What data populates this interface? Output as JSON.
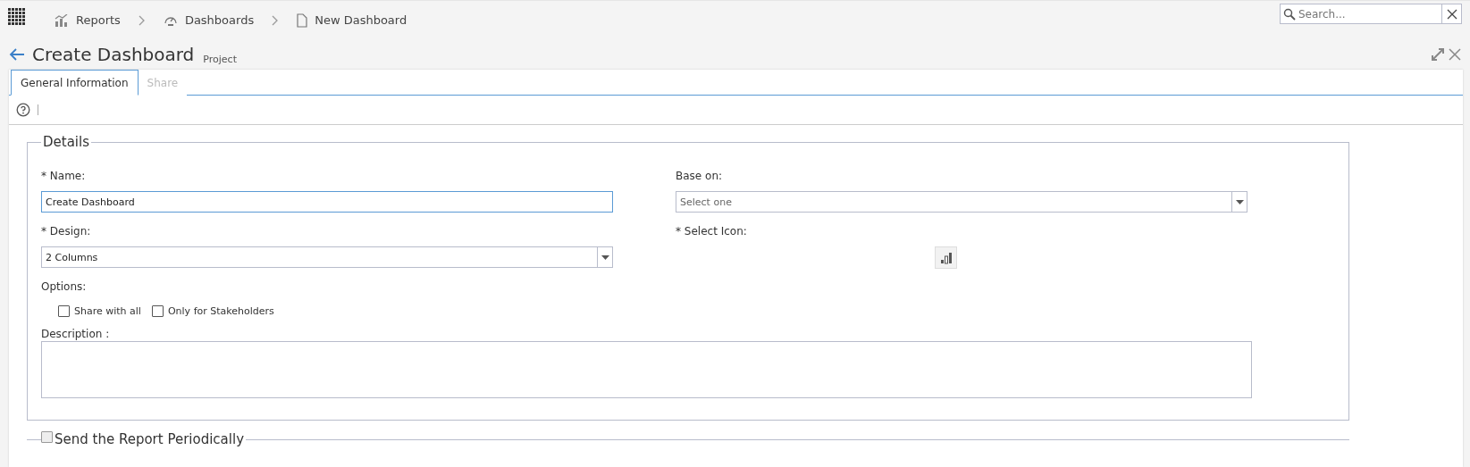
{
  "breadcrumbs": [
    {
      "label": "Reports"
    },
    {
      "label": "Dashboards"
    },
    {
      "label": "New Dashboard"
    }
  ],
  "search": {
    "placeholder": "Search..."
  },
  "page": {
    "title": "Create Dashboard",
    "subtitle": "Project"
  },
  "tabs": [
    {
      "label": "General Information",
      "selected": true
    },
    {
      "label": "Share",
      "selected": false
    }
  ],
  "details": {
    "legend": "Details",
    "name": {
      "label": "* Name:",
      "value": "Create Dashboard"
    },
    "design": {
      "label": "* Design:",
      "value": "2 Columns"
    },
    "options": {
      "label": "Options:",
      "items": [
        {
          "label": "Share with all",
          "checked": false
        },
        {
          "label": "Only for Stakeholders",
          "checked": false
        }
      ]
    },
    "description": {
      "label": "Description :"
    },
    "base_on": {
      "label": "Base on:",
      "placeholder": "Select one"
    },
    "select_icon": {
      "label": "* Select Icon:"
    }
  },
  "send_report": {
    "label": "Send the Report Periodically",
    "checked": false
  }
}
